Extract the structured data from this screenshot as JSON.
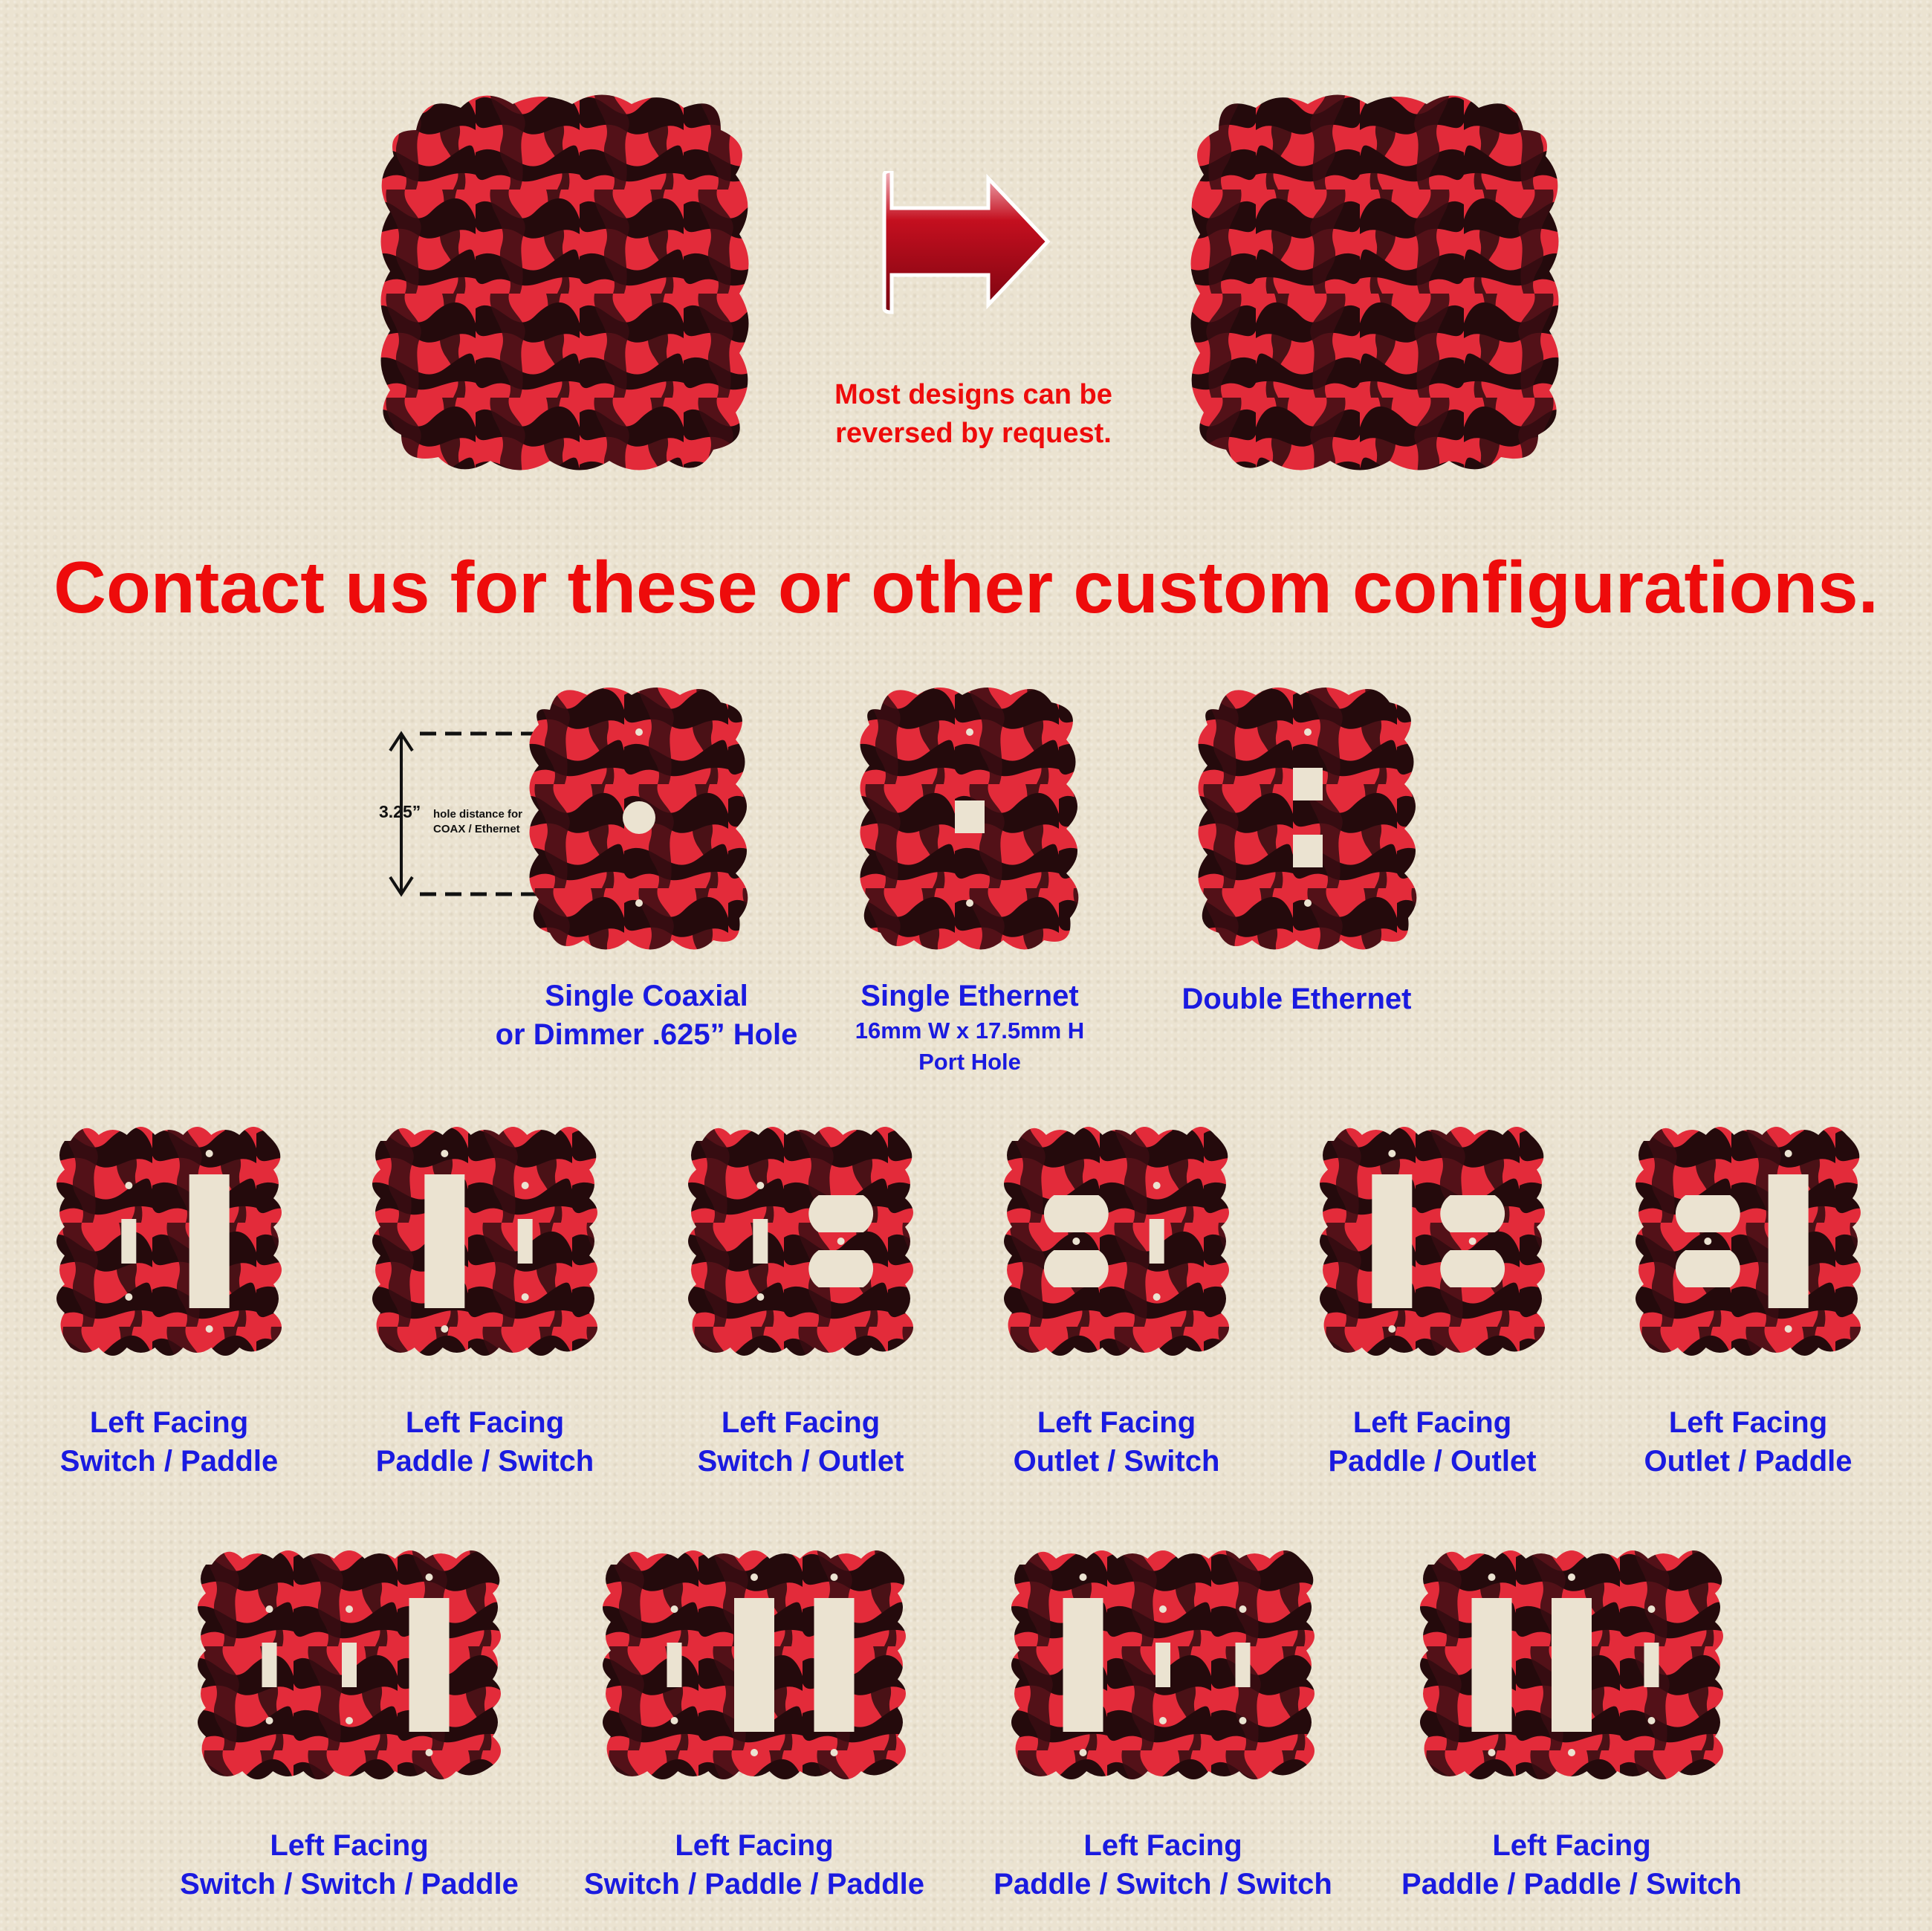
{
  "colors": {
    "plate_red": "#e32b3a",
    "plate_dark": "#240a0c",
    "label_blue": "#1a1ae0",
    "headline_red": "#ee0b0b"
  },
  "reverse_note": [
    "Most designs can be",
    "reversed by request."
  ],
  "headline": "Contact us for these or other custom configurations.",
  "dimension": {
    "value": "3.25”",
    "note": [
      "hole distance for",
      "COAX / Ethernet"
    ]
  },
  "top_plates": [
    {
      "name": "original-design-plate"
    },
    {
      "name": "reversed-design-plate"
    }
  ],
  "row1": [
    {
      "lines": [
        "Single Coaxial",
        "or Dimmer .625” Hole"
      ]
    },
    {
      "lines": [
        "Single Ethernet"
      ],
      "sub": [
        "16mm W x 17.5mm H",
        "Port Hole"
      ]
    },
    {
      "lines": [
        "Double Ethernet"
      ]
    }
  ],
  "row2": [
    {
      "lines": [
        "Left Facing",
        "Switch / Paddle"
      ]
    },
    {
      "lines": [
        "Left Facing",
        "Paddle / Switch"
      ]
    },
    {
      "lines": [
        "Left Facing",
        "Switch / Outlet"
      ]
    },
    {
      "lines": [
        "Left Facing",
        "Outlet / Switch"
      ]
    },
    {
      "lines": [
        "Left Facing",
        "Paddle / Outlet"
      ]
    },
    {
      "lines": [
        "Left Facing",
        "Outlet / Paddle"
      ]
    }
  ],
  "row3": [
    {
      "lines": [
        "Left Facing",
        "Switch / Switch / Paddle"
      ]
    },
    {
      "lines": [
        "Left Facing",
        "Switch / Paddle / Paddle"
      ]
    },
    {
      "lines": [
        "Left Facing",
        "Paddle / Switch / Switch"
      ]
    },
    {
      "lines": [
        "Left Facing",
        "Paddle / Paddle / Switch"
      ]
    }
  ]
}
